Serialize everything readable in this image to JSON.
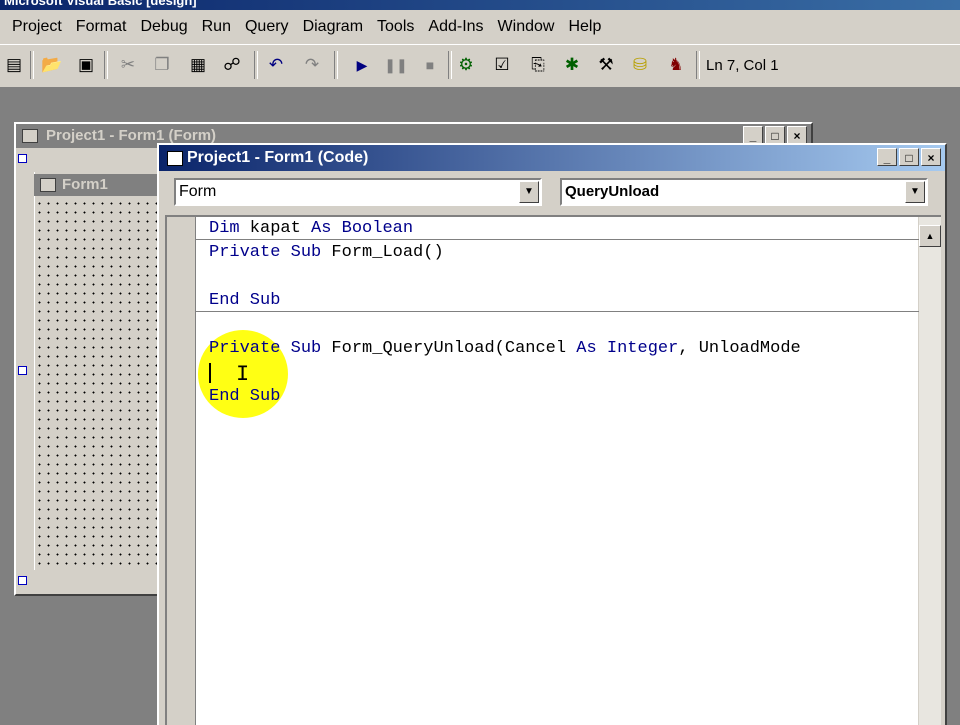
{
  "window": {
    "title_fragment": "Microsoft Visual Basic [design]"
  },
  "menu": [
    "Project",
    "Format",
    "Debug",
    "Run",
    "Query",
    "Diagram",
    "Tools",
    "Add-Ins",
    "Window",
    "Help"
  ],
  "toolbar": {
    "cursor_position": "Ln 7, Col 1"
  },
  "project_window": {
    "title": "Project1 - Form1 (Form)",
    "form_caption": "Form1"
  },
  "code_window": {
    "title": "Project1 - Form1 (Code)",
    "object_combo": "Form",
    "procedure_combo": "QueryUnload",
    "lines": {
      "l1_kw1": "Dim",
      "l1_rest": " kapat ",
      "l1_kw2": "As",
      "l1_kw3": " Boolean",
      "l2_kw1": "Private",
      "l2_kw2": " Sub",
      "l2_rest": " Form_Load()",
      "l4_kw1": "End",
      "l4_kw2": " Sub",
      "l6_kw1": "Private",
      "l6_kw2": " Sub",
      "l6_rest1": " Form_QueryUnload(Cancel ",
      "l6_kw3": "As",
      "l6_kw4": " Integer",
      "l6_rest2": ", UnloadMode",
      "l8_kw1": "End",
      "l8_kw2": " Sub"
    }
  },
  "icons": [
    "new-project-icon",
    "open-icon",
    "save-icon",
    "cut-icon",
    "copy-icon",
    "paste-icon",
    "find-icon",
    "undo-icon",
    "redo-icon",
    "start-icon",
    "break-icon",
    "end-icon",
    "project-explorer-icon",
    "properties-icon",
    "form-layout-icon",
    "object-browser-icon",
    "toolbox-icon",
    "data-view-icon",
    "component-manager-icon"
  ],
  "colors": {
    "keyword": "#00008b",
    "highlight": "#ffff00",
    "title_active": "#0a246a"
  }
}
